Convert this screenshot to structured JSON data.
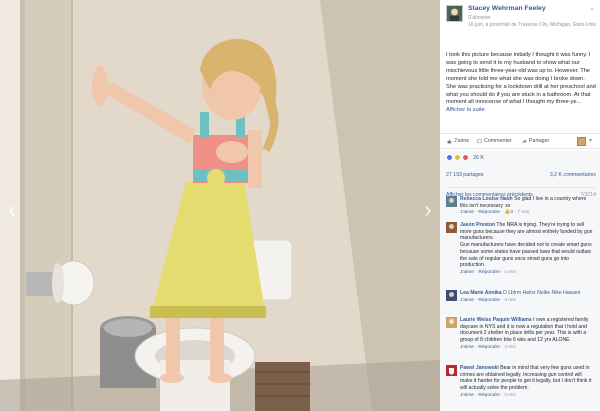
{
  "nav": {
    "prev_icon": "chevron-left-icon",
    "next_icon": "chevron-right-icon",
    "prev_glyph": "‹",
    "next_glyph": "›"
  },
  "post": {
    "author": "Stacey Wehrman Feeley",
    "follow": "S'abonner",
    "meta": "16 juin, à proximité de Traverse City, Michigan, États-Unis ·",
    "chevron": "⌄",
    "body": "I took this picture because initially I thought it was funny. I was going to send it to my husband to show what our mischievous little three-year-old was up to. However. The moment she told me what she was doing I broke down. She was practicing for a lockdown drill at her preschool and what you should do if you are stuck in a bathroom. At that moment all innocense of what I thought my three-ye...",
    "more": "Afficher la suite"
  },
  "actions": {
    "like": "J'aime",
    "comment": "Commenter",
    "share": "Partager",
    "caret": "▾"
  },
  "feedback": {
    "reaction_count": "26 K",
    "shares": "27 193 partages",
    "comments_count": "3,2 K commentaires",
    "prev_comments": "Afficher les commentaires précédents",
    "prev_counter": "7/3214"
  },
  "comments": [
    {
      "name": "Rebecca Louise Nash",
      "text": " So glad I live in a country where this isn't necessary",
      "suffix": "  xx",
      "like": "J'aime",
      "reply": "Répondre",
      "likes": "3",
      "time": "7 min",
      "avatar_color": "#5a7f8f"
    },
    {
      "name": "Jason Preston",
      "text": " The NRA is trying. They're trying to sell more guns because they are almost entirely funded by gun manufacturers.",
      "text2": "Gun manufacturers have decided not to create smart guns because some states have passed laws that would outlaw the sale of regular guns once smart guns go into production.",
      "like": "J'aime",
      "reply": "Répondre",
      "time": "4 min",
      "avatar_color": "#8c5b3b"
    },
    {
      "name": "Lea Marie Annika",
      "text": " D Lblrrn Heinz Nolke Nike Hassen",
      "like": "J'aime",
      "reply": "Répondre",
      "time": "4 min",
      "avatar_color": "#3e4e7a"
    },
    {
      "name": "Laurie Weiss Paquin Williams",
      "text": " I own a registered family daycare in NYS and it is now a regulation that I hold and document 2 shelter in place drills per year. This is with a group of 8 children btw 6 wks and 12 yrs ALONE",
      "like": "J'aime",
      "reply": "Répondre",
      "time": "4 min",
      "avatar_color": "#c9a56a"
    },
    {
      "name": "Pawel Janowski",
      "text": " Bear in mind that very few guns used in crimes are obtained legally. Increasing gun control will make it harder for people to get it legally, but I don't think it will actually solve the problem.",
      "like": "J'aime",
      "reply": "Répondre",
      "time": "3 min",
      "avatar_color": "#b32b2b"
    }
  ]
}
